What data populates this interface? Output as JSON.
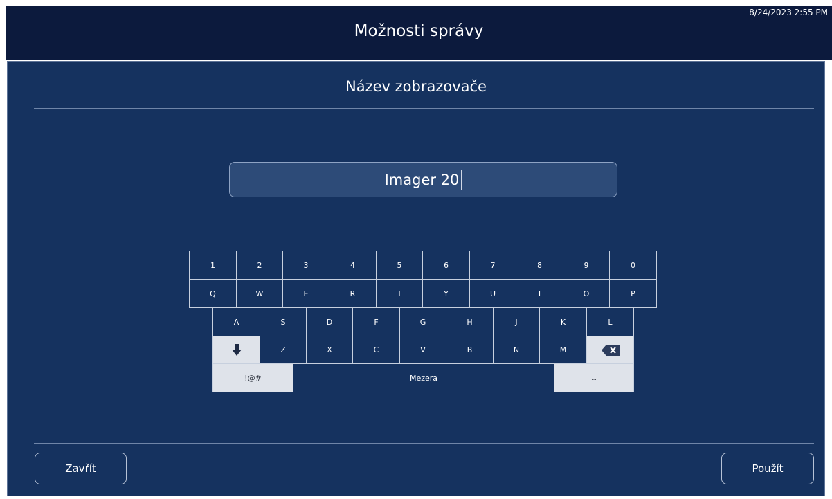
{
  "header": {
    "title": "Možnosti správy",
    "datetime": "8/24/2023 2:55 PM"
  },
  "dialog": {
    "title": "Název zobrazovače",
    "name_field": {
      "value": "Imager 20"
    }
  },
  "keyboard": {
    "row_numbers": [
      "1",
      "2",
      "3",
      "4",
      "5",
      "6",
      "7",
      "8",
      "9",
      "0"
    ],
    "row_top": [
      "Q",
      "W",
      "E",
      "R",
      "T",
      "Y",
      "U",
      "I",
      "O",
      "P"
    ],
    "row_home": [
      "A",
      "S",
      "D",
      "F",
      "G",
      "H",
      "J",
      "K",
      "L"
    ],
    "row_bottom": [
      "Z",
      "X",
      "C",
      "V",
      "B",
      "N",
      "M"
    ],
    "shift_icon": "down-arrow-icon",
    "backspace_icon": "backspace-icon",
    "symbols_label": "!@#",
    "space_label": "Mezera",
    "ellipsis_label": "..."
  },
  "footer": {
    "close_label": "Zavřít",
    "apply_label": "Použít"
  },
  "colors": {
    "header_bg": "#0c1a3d",
    "dialog_bg": "#15325f",
    "field_bg": "#2d4b78",
    "light_key": "#dfe3ea"
  }
}
